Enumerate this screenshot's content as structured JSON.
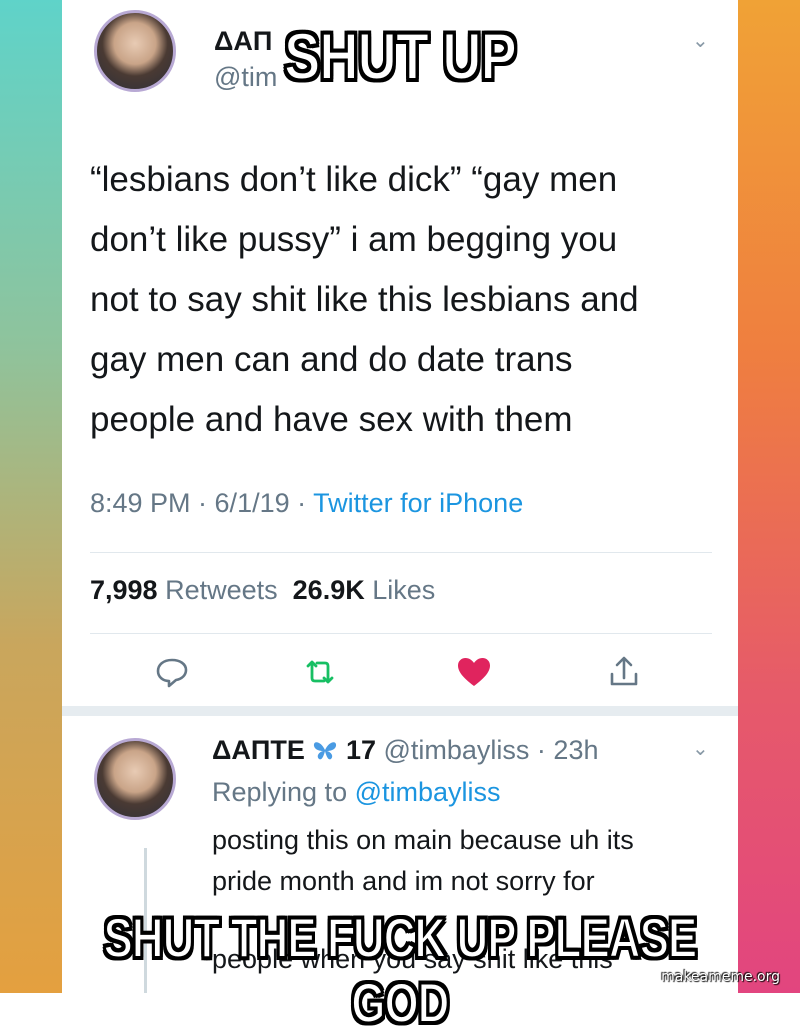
{
  "tweet": {
    "name_partial": "ΔΑΠ",
    "handle_partial": "@tim",
    "text_lines": [
      "“lesbians don’t like dick” “gay men",
      "don’t like pussy” i am begging you",
      "not to say shit like this lesbians and",
      "gay men can and do date trans",
      "people and have sex with them"
    ],
    "time": "8:49 PM · 6/1/19 · ",
    "source": "Twitter for iPhone",
    "retweets_count": "7,998",
    "retweets_label": " Retweets",
    "likes_count": "26.9K",
    "likes_label": " Likes",
    "chevron": "⌄"
  },
  "reply": {
    "name": "ΔΑΠΤΕ",
    "badge": "17",
    "handle_time": "@timbayliss · 23h",
    "replying_prefix": "Replying to ",
    "replying_handle": "@timbayliss",
    "text_lines": [
      "posting this on main because uh its",
      "pride month and im not sorry for",
      "people when you say shit like this"
    ],
    "chevron": "⌄"
  },
  "meme": {
    "top_text": "SHUT UP",
    "bottom_text": "SHUT THE FUCK UP PLEASE GOD",
    "watermark": "makeameme.org"
  },
  "colors": {
    "like_heart": "#e0245e",
    "retweet": "#17bf63",
    "link": "#1b95e0"
  }
}
